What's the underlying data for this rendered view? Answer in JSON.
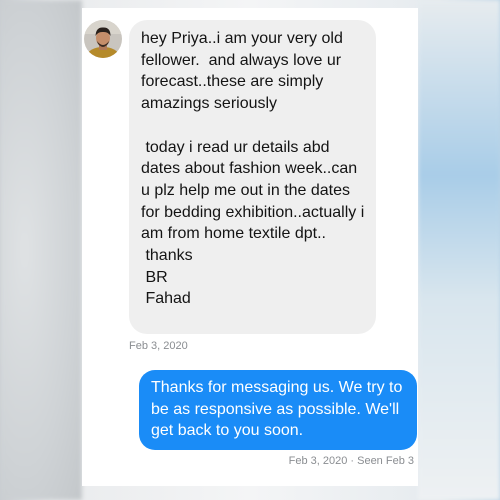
{
  "conversation": {
    "incoming": {
      "sender_avatar_icon": "user-avatar",
      "message": "hey Priya..i am your very old fellower.  and always love ur forecast..these are simply amazings seriously\n\n today i read ur details abd dates about fashion week..can u plz help me out in the dates for bedding exhibition..actually i am from home textile dpt..\n thanks\n BR\n Fahad",
      "timestamp": "Feb 3, 2020"
    },
    "outgoing": {
      "message": "Thanks for messaging us. We try to be as responsive as possible. We'll get back to you soon.",
      "status": "Feb 3, 2020 · Seen Feb 3"
    }
  },
  "colors": {
    "incoming_bubble": "#efefef",
    "outgoing_bubble": "#1a8cf7",
    "timestamp_text": "#8a8d91"
  }
}
